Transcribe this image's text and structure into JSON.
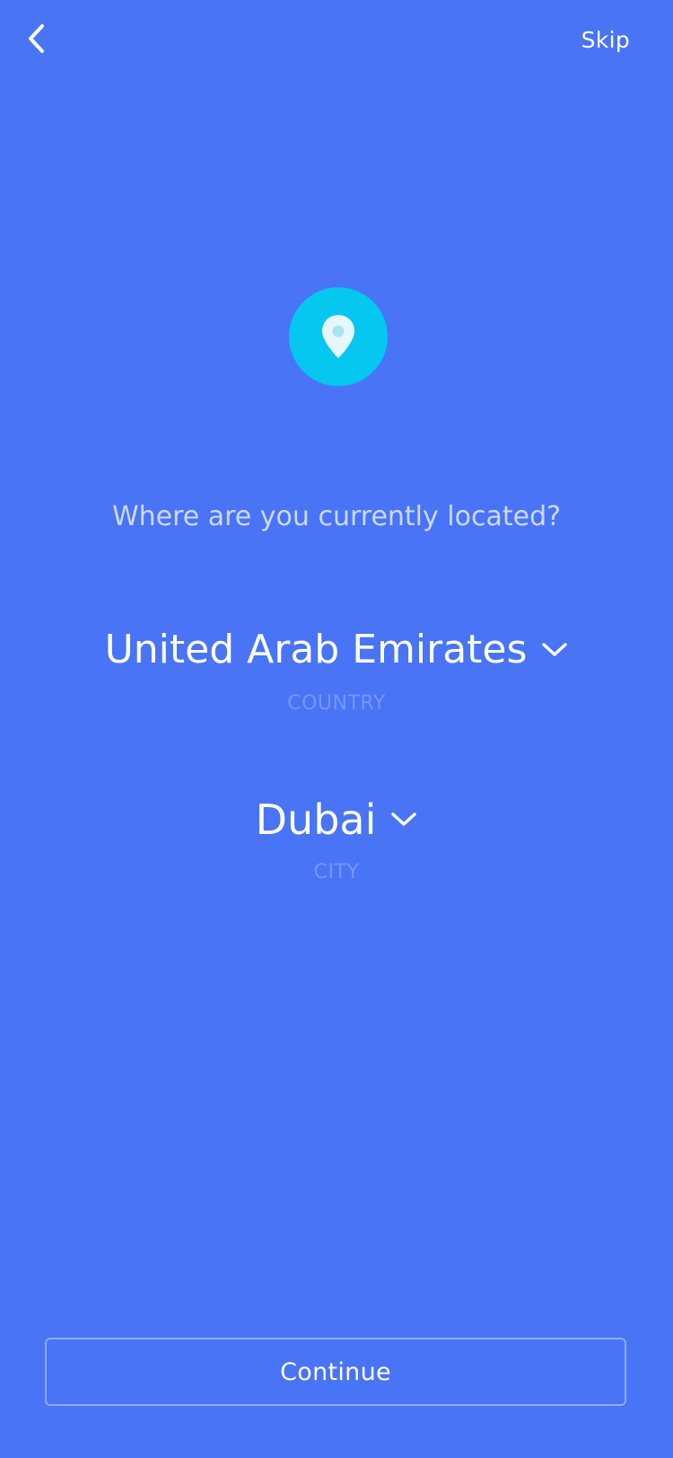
{
  "header": {
    "back_icon": "chevron-left-icon",
    "skip_label": "Skip"
  },
  "hero": {
    "icon": "location-pin-icon",
    "badge_color": "#05C7F0"
  },
  "question": "Where are you currently located?",
  "country": {
    "value": "United Arab Emirates",
    "caption": "COUNTRY",
    "icon": "chevron-down-icon"
  },
  "city": {
    "value": "Dubai",
    "caption": "CITY",
    "icon": "chevron-down-icon"
  },
  "continue_label": "Continue",
  "colors": {
    "background": "#4874F5",
    "accent": "#05C7F0",
    "text": "#FFFFFF"
  }
}
